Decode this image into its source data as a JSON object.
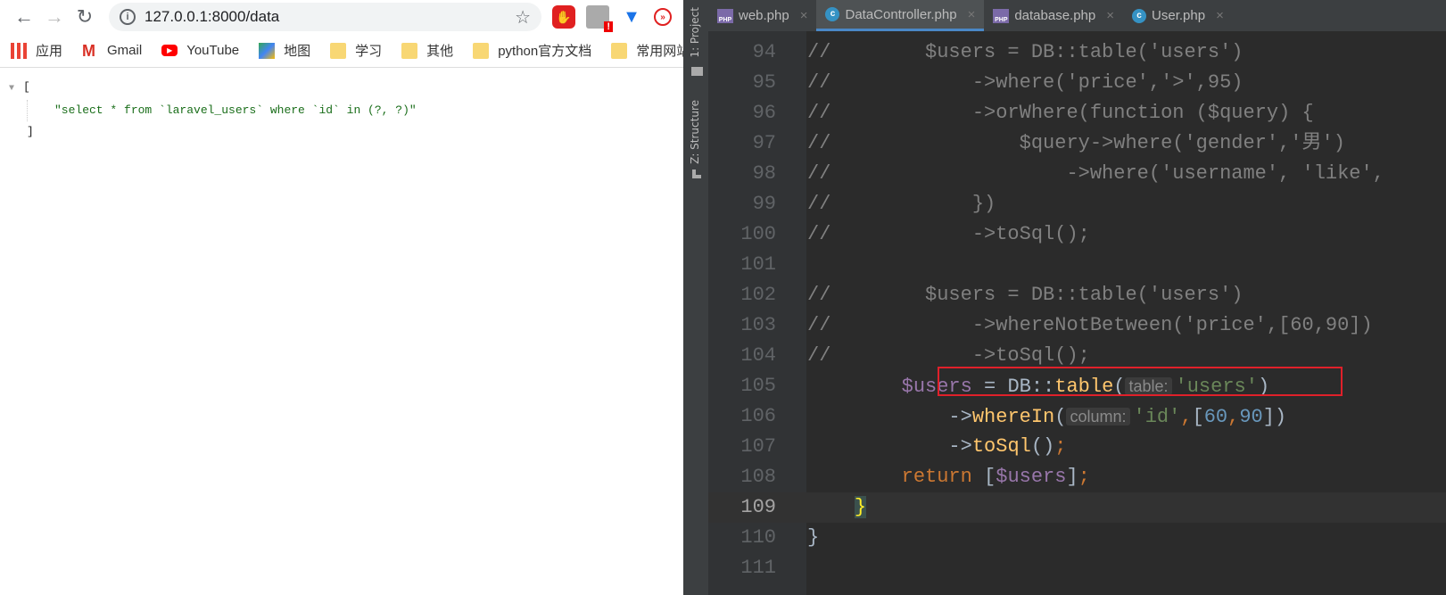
{
  "browser": {
    "url": "127.0.0.1:8000/data",
    "bookmarks": [
      "应用",
      "Gmail",
      "YouTube",
      "地图",
      "学习",
      "其他",
      "python官方文档",
      "常用网站"
    ],
    "json_open": "[",
    "json_value": "\"select * from `laravel_users` where `id` in (?, ?)\"",
    "json_close": "]"
  },
  "ide": {
    "side_labels": [
      "1: Project",
      "Z: Structure"
    ],
    "tabs": [
      {
        "label": "web.php",
        "icon": "php-file-icon"
      },
      {
        "label": "DataController.php",
        "icon": "php-class-icon",
        "active": true
      },
      {
        "label": "database.php",
        "icon": "php-file-icon"
      },
      {
        "label": "User.php",
        "icon": "php-class-icon"
      }
    ],
    "current_line": 109,
    "lines": [
      {
        "n": "94",
        "t": [
          [
            "cm",
            "//        $users = DB::table('users')"
          ]
        ]
      },
      {
        "n": "95",
        "t": [
          [
            "cm",
            "//            ->where('price','>',95)"
          ]
        ]
      },
      {
        "n": "96",
        "t": [
          [
            "cm",
            "//            ->orWhere(function ($query) {"
          ]
        ]
      },
      {
        "n": "97",
        "t": [
          [
            "cm",
            "//                $query->where('gender','男')"
          ]
        ]
      },
      {
        "n": "98",
        "t": [
          [
            "cm",
            "//                    ->where('username', 'like',"
          ]
        ]
      },
      {
        "n": "99",
        "t": [
          [
            "cm",
            "//            })"
          ]
        ]
      },
      {
        "n": "100",
        "t": [
          [
            "cm",
            "//            ->toSql();"
          ]
        ]
      },
      {
        "n": "101",
        "t": []
      },
      {
        "n": "102",
        "t": [
          [
            "cm",
            "//        $users = DB::table('users')"
          ]
        ]
      },
      {
        "n": "103",
        "t": [
          [
            "cm",
            "//            ->whereNotBetween('price',[60,90])"
          ]
        ]
      },
      {
        "n": "104",
        "t": [
          [
            "cm",
            "//            ->toSql();"
          ]
        ]
      },
      {
        "n": "105",
        "t": [
          [
            "",
            "        "
          ],
          [
            "var",
            "$users"
          ],
          [
            "",
            " = DB::"
          ],
          [
            "fn",
            "table"
          ],
          [
            "",
            "("
          ],
          [
            "hint",
            "table:"
          ],
          [
            "s",
            "'users'"
          ],
          [
            "",
            ")"
          ]
        ]
      },
      {
        "n": "106",
        "t": [
          [
            "",
            "            ->"
          ],
          [
            "fn",
            "whereIn"
          ],
          [
            "",
            "("
          ],
          [
            "hint",
            "column:"
          ],
          [
            "s",
            "'id'"
          ],
          [
            "kw",
            ","
          ],
          [
            "",
            "["
          ],
          [
            "n",
            "60"
          ],
          [
            "kw",
            ","
          ],
          [
            "n",
            "90"
          ],
          [
            "",
            "])"
          ]
        ]
      },
      {
        "n": "107",
        "t": [
          [
            "",
            "            ->"
          ],
          [
            "fn",
            "toSql"
          ],
          [
            "",
            "()"
          ],
          [
            "kw",
            ";"
          ]
        ]
      },
      {
        "n": "108",
        "t": [
          [
            "kw",
            "        return "
          ],
          [
            "",
            "["
          ],
          [
            "var",
            "$users"
          ],
          [
            "",
            "]"
          ],
          [
            "kw",
            ";"
          ]
        ]
      },
      {
        "n": "109",
        "t": [
          [
            "",
            "    "
          ],
          [
            "br",
            "}"
          ]
        ]
      },
      {
        "n": "110",
        "t": [
          [
            "",
            "}"
          ]
        ]
      },
      {
        "n": "111",
        "t": []
      }
    ]
  }
}
